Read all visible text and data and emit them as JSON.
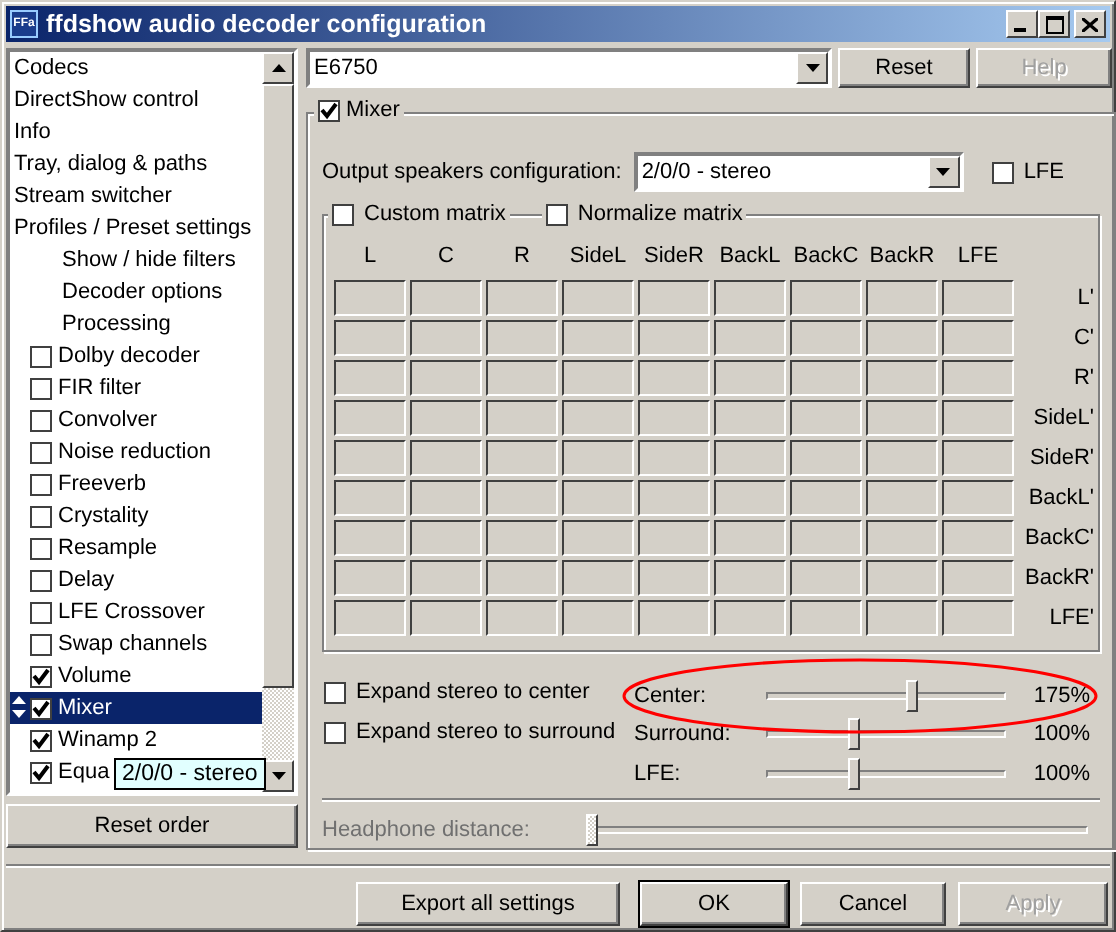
{
  "window": {
    "title": "ffdshow audio decoder configuration",
    "icon_text": "FFa"
  },
  "sidebar": {
    "items": [
      {
        "kind": "page",
        "label": "Codecs",
        "selected": false
      },
      {
        "kind": "page",
        "label": "DirectShow control",
        "selected": false
      },
      {
        "kind": "page",
        "label": "Info",
        "selected": false
      },
      {
        "kind": "page",
        "label": "Tray, dialog & paths",
        "selected": false
      },
      {
        "kind": "page",
        "label": "Stream switcher",
        "selected": false
      },
      {
        "kind": "page",
        "label": "Profiles / Preset settings",
        "selected": false
      },
      {
        "kind": "subpage",
        "label": "Show / hide filters",
        "selected": false
      },
      {
        "kind": "subpage",
        "label": "Decoder options",
        "selected": false
      },
      {
        "kind": "subpage",
        "label": "Processing",
        "selected": false
      },
      {
        "kind": "filter",
        "label": "Dolby decoder",
        "checked": false,
        "selected": false
      },
      {
        "kind": "filter",
        "label": "FIR filter",
        "checked": false,
        "selected": false
      },
      {
        "kind": "filter",
        "label": "Convolver",
        "checked": false,
        "selected": false
      },
      {
        "kind": "filter",
        "label": "Noise reduction",
        "checked": false,
        "selected": false
      },
      {
        "kind": "filter",
        "label": "Freeverb",
        "checked": false,
        "selected": false
      },
      {
        "kind": "filter",
        "label": "Crystality",
        "checked": false,
        "selected": false
      },
      {
        "kind": "filter",
        "label": "Resample",
        "checked": false,
        "selected": false
      },
      {
        "kind": "filter",
        "label": "Delay",
        "checked": false,
        "selected": false
      },
      {
        "kind": "filter",
        "label": "LFE Crossover",
        "checked": false,
        "selected": false
      },
      {
        "kind": "filter",
        "label": "Swap channels",
        "checked": false,
        "selected": false
      },
      {
        "kind": "filter",
        "label": "Volume",
        "checked": true,
        "selected": false
      },
      {
        "kind": "filter",
        "label": "Mixer",
        "checked": true,
        "selected": true
      },
      {
        "kind": "filter",
        "label": "Winamp 2",
        "checked": true,
        "selected": false
      },
      {
        "kind": "filter",
        "label": "Equa",
        "checked": true,
        "selected": false
      }
    ],
    "reset_button": "Reset order"
  },
  "tooltip": "2/0/0 - stereo",
  "preset": {
    "value": "E6750",
    "buttons": [
      {
        "label": "Reset",
        "disabled": false
      },
      {
        "label": "Help",
        "disabled": true
      }
    ]
  },
  "mixer": {
    "enabled": {
      "label": "Mixer",
      "checked": true
    },
    "output_config": {
      "label": "Output speakers configuration:",
      "value": "2/0/0 - stereo"
    },
    "lfe": {
      "label": "LFE",
      "checked": false
    },
    "custom_matrix": {
      "label": "Custom matrix",
      "checked": false
    },
    "normalize_matrix": {
      "label": "Normalize matrix",
      "checked": false
    },
    "columns": [
      "L",
      "C",
      "R",
      "SideL",
      "SideR",
      "BackL",
      "BackC",
      "BackR",
      "LFE"
    ],
    "rows": [
      "L'",
      "C'",
      "R'",
      "SideL'",
      "SideR'",
      "BackL'",
      "BackC'",
      "BackR'",
      "LFE'"
    ],
    "expand_options": [
      {
        "label": "Expand stereo to center",
        "checked": false
      },
      {
        "label": "Expand stereo to surround",
        "checked": false
      }
    ],
    "sliders": [
      {
        "label": "Center:",
        "level": 0.58,
        "reading": "175%"
      },
      {
        "label": "Surround:",
        "level": 0.34,
        "reading": "100%"
      },
      {
        "label": "LFE:",
        "level": 0.34,
        "reading": "100%"
      }
    ],
    "headphone": {
      "label": "Headphone distance:",
      "level": 0,
      "disabled": true
    }
  },
  "footer_buttons": [
    {
      "label": "Export all settings",
      "default": false,
      "disabled": false
    },
    {
      "label": "OK",
      "default": true,
      "disabled": false
    },
    {
      "label": "Cancel",
      "default": false,
      "disabled": false
    },
    {
      "label": "Apply",
      "default": false,
      "disabled": true
    }
  ]
}
